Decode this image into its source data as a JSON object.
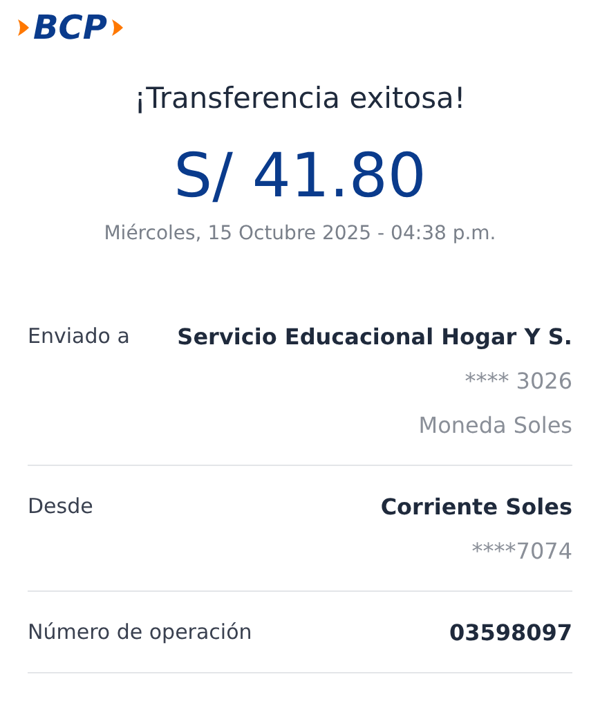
{
  "logo": {
    "text": "BCP"
  },
  "title": "¡Transferencia exitosa!",
  "amount": "S/ 41.80",
  "datetime": "Miércoles, 15 Octubre 2025 - 04:38 p.m.",
  "details": [
    {
      "label": "Enviado a",
      "values": [
        {
          "kind": "main",
          "text": "Servicio Educacional Hogar Y S."
        },
        {
          "kind": "sub",
          "text": "**** 3026"
        },
        {
          "kind": "sub",
          "text": "Moneda Soles"
        }
      ]
    },
    {
      "label": "Desde",
      "values": [
        {
          "kind": "main",
          "text": "Corriente Soles"
        },
        {
          "kind": "sub",
          "text": "****7074"
        }
      ]
    },
    {
      "label": "Número de operación",
      "values": [
        {
          "kind": "main",
          "text": "03598097"
        }
      ]
    }
  ]
}
